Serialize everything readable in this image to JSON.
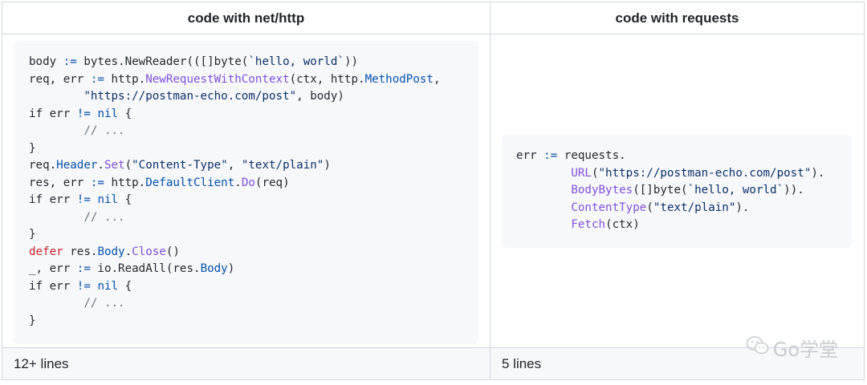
{
  "table": {
    "headers": [
      "code with net/http",
      "code with requests"
    ],
    "footers": [
      "12+ lines",
      "5 lines"
    ]
  },
  "code_left": [
    [
      [
        "body ",
        "p"
      ],
      [
        ":=",
        "o"
      ],
      [
        " bytes.NewReader(([]byte(",
        "p"
      ],
      [
        "`hello, world`",
        "s"
      ],
      [
        "))",
        "p"
      ]
    ],
    [
      [
        "req, err ",
        "p"
      ],
      [
        ":=",
        "o"
      ],
      [
        " http.",
        "p"
      ],
      [
        "NewRequestWithContext",
        "f"
      ],
      [
        "(ctx, http.",
        "p"
      ],
      [
        "MethodPost",
        "m"
      ],
      [
        ",",
        "p"
      ]
    ],
    [
      [
        "        ",
        "p"
      ],
      [
        "\"https://postman-echo.com/post\"",
        "s"
      ],
      [
        ", body)",
        "p"
      ]
    ],
    [
      [
        "if err ",
        "p"
      ],
      [
        "!=",
        "o"
      ],
      [
        " ",
        "p"
      ],
      [
        "nil",
        "o"
      ],
      [
        " {",
        "p"
      ]
    ],
    [
      [
        "        ",
        "p"
      ],
      [
        "// ...",
        "c"
      ]
    ],
    [
      [
        "}",
        "p"
      ]
    ],
    [
      [
        "req.",
        "p"
      ],
      [
        "Header",
        "m"
      ],
      [
        ".",
        "p"
      ],
      [
        "Set",
        "f"
      ],
      [
        "(",
        "p"
      ],
      [
        "\"Content-Type\"",
        "s"
      ],
      [
        ", ",
        "p"
      ],
      [
        "\"text/plain\"",
        "s"
      ],
      [
        ")",
        "p"
      ]
    ],
    [
      [
        "res, err ",
        "p"
      ],
      [
        ":=",
        "o"
      ],
      [
        " http.",
        "p"
      ],
      [
        "DefaultClient",
        "m"
      ],
      [
        ".",
        "p"
      ],
      [
        "Do",
        "f"
      ],
      [
        "(req)",
        "p"
      ]
    ],
    [
      [
        "if err ",
        "p"
      ],
      [
        "!=",
        "o"
      ],
      [
        " ",
        "p"
      ],
      [
        "nil",
        "o"
      ],
      [
        " {",
        "p"
      ]
    ],
    [
      [
        "        ",
        "p"
      ],
      [
        "// ...",
        "c"
      ]
    ],
    [
      [
        "}",
        "p"
      ]
    ],
    [
      [
        "defer",
        "k"
      ],
      [
        " res.",
        "p"
      ],
      [
        "Body",
        "m"
      ],
      [
        ".",
        "p"
      ],
      [
        "Close",
        "f"
      ],
      [
        "()",
        "p"
      ]
    ],
    [
      [
        "_, err ",
        "p"
      ],
      [
        ":=",
        "o"
      ],
      [
        " io.ReadAll(res.",
        "p"
      ],
      [
        "Body",
        "m"
      ],
      [
        ")",
        "p"
      ]
    ],
    [
      [
        "if err ",
        "p"
      ],
      [
        "!=",
        "o"
      ],
      [
        " ",
        "p"
      ],
      [
        "nil",
        "o"
      ],
      [
        " {",
        "p"
      ]
    ],
    [
      [
        "        ",
        "p"
      ],
      [
        "// ...",
        "c"
      ]
    ],
    [
      [
        "}",
        "p"
      ]
    ]
  ],
  "code_right": [
    [
      [
        "err ",
        "p"
      ],
      [
        ":=",
        "o"
      ],
      [
        " requests.",
        "p"
      ]
    ],
    [
      [
        "        ",
        "p"
      ],
      [
        "URL",
        "f"
      ],
      [
        "(",
        "p"
      ],
      [
        "\"https://postman-echo.com/post\"",
        "s"
      ],
      [
        ").",
        "p"
      ]
    ],
    [
      [
        "        ",
        "p"
      ],
      [
        "BodyBytes",
        "f"
      ],
      [
        "([]byte(",
        "p"
      ],
      [
        "`hello, world`",
        "s"
      ],
      [
        ")).",
        "p"
      ]
    ],
    [
      [
        "        ",
        "p"
      ],
      [
        "ContentType",
        "f"
      ],
      [
        "(",
        "p"
      ],
      [
        "\"text/plain\"",
        "s"
      ],
      [
        ").",
        "p"
      ]
    ],
    [
      [
        "        ",
        "p"
      ],
      [
        "Fetch",
        "f"
      ],
      [
        "(ctx)",
        "p"
      ]
    ]
  ],
  "watermark": {
    "icon": "wechat-icon",
    "text": "Go学堂"
  }
}
